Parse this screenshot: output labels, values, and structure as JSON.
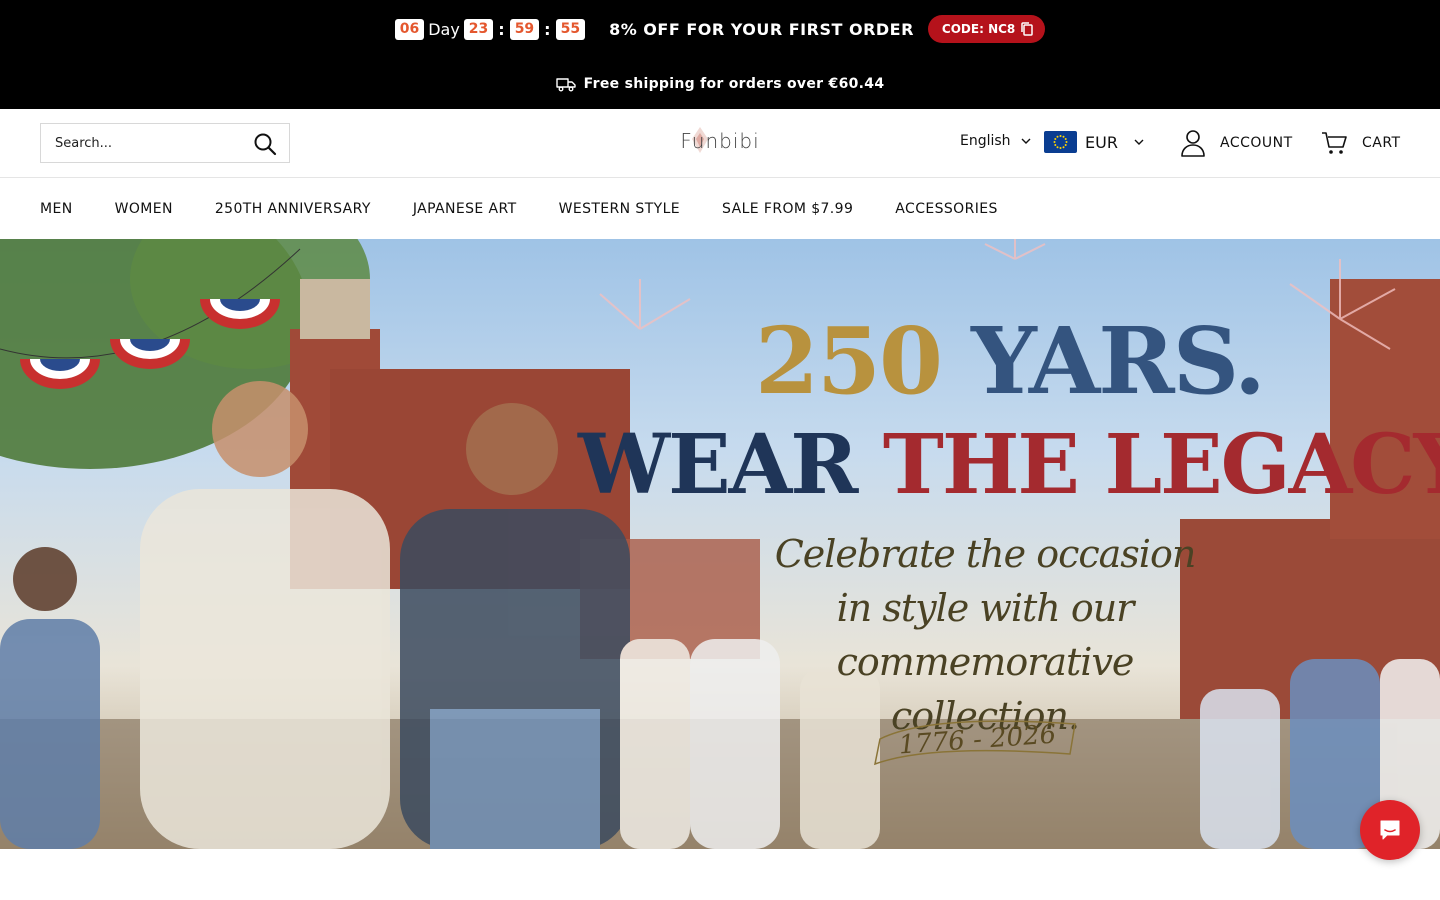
{
  "announcement": {
    "countdown": {
      "days": "06",
      "day_label": "Day",
      "hours": "23",
      "minutes": "59",
      "seconds": "55",
      "separator": ":"
    },
    "promo_text": "8% OFF FOR YOUR FIRST ORDER",
    "code_label": "CODE: NC8",
    "shipping_text": "Free shipping for orders over €60.44",
    "icons": {
      "copy": "copy-icon",
      "shipping": "truck-icon"
    }
  },
  "header": {
    "search_placeholder": "Search...",
    "logo_text": "Funbibi",
    "language": "English",
    "currency": "EUR",
    "account_label": "ACCOUNT",
    "cart_label": "CART"
  },
  "nav": {
    "items": [
      {
        "label": "MEN"
      },
      {
        "label": "WOMEN"
      },
      {
        "label": "250TH ANNIVERSARY"
      },
      {
        "label": "JAPANESE ART"
      },
      {
        "label": "WESTERN STYLE"
      },
      {
        "label": "SALE FROM $7.99"
      },
      {
        "label": "ACCESSORIES"
      }
    ]
  },
  "hero": {
    "headline_1a": "250",
    "headline_1b": " YARS.",
    "headline_2a": "WEAR ",
    "headline_2b": "THE LEGACY.",
    "subheadline": "Celebrate the occasion in style with our commemorative collection.",
    "years_badge": "1776 - 2026"
  },
  "colors": {
    "announcement_bg": "#000000",
    "countdown_digit": "#e4572e",
    "code_button": "#b5121b",
    "chat_button": "#e02329",
    "navy": "#1f3558",
    "gold": "#b8923e",
    "red": "#a42a2f"
  },
  "chat": {
    "icon": "chat-icon"
  }
}
